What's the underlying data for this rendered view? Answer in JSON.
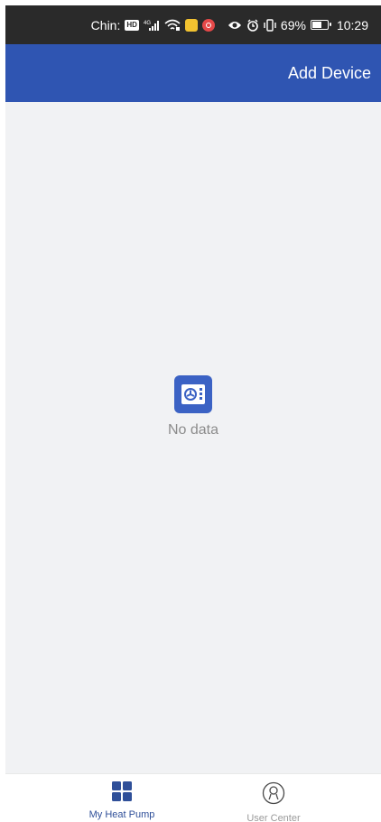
{
  "status_bar": {
    "carrier": "Chin:",
    "hd_badge": "HD",
    "network": "4G",
    "battery_percent": "69%",
    "battery_level": 0.69,
    "time": "10:29"
  },
  "header": {
    "add_device_label": "Add Device",
    "background_color": "#2f55b2"
  },
  "main": {
    "empty_state_text": "No data",
    "empty_icon": "device-placeholder-icon"
  },
  "bottom_nav": {
    "items": [
      {
        "label": "My Heat Pump",
        "icon": "grid-icon",
        "active": true
      },
      {
        "label": "User Center",
        "icon": "user-icon",
        "active": false
      }
    ],
    "active_color": "#2f4f99",
    "inactive_color": "#9a9a9a"
  }
}
